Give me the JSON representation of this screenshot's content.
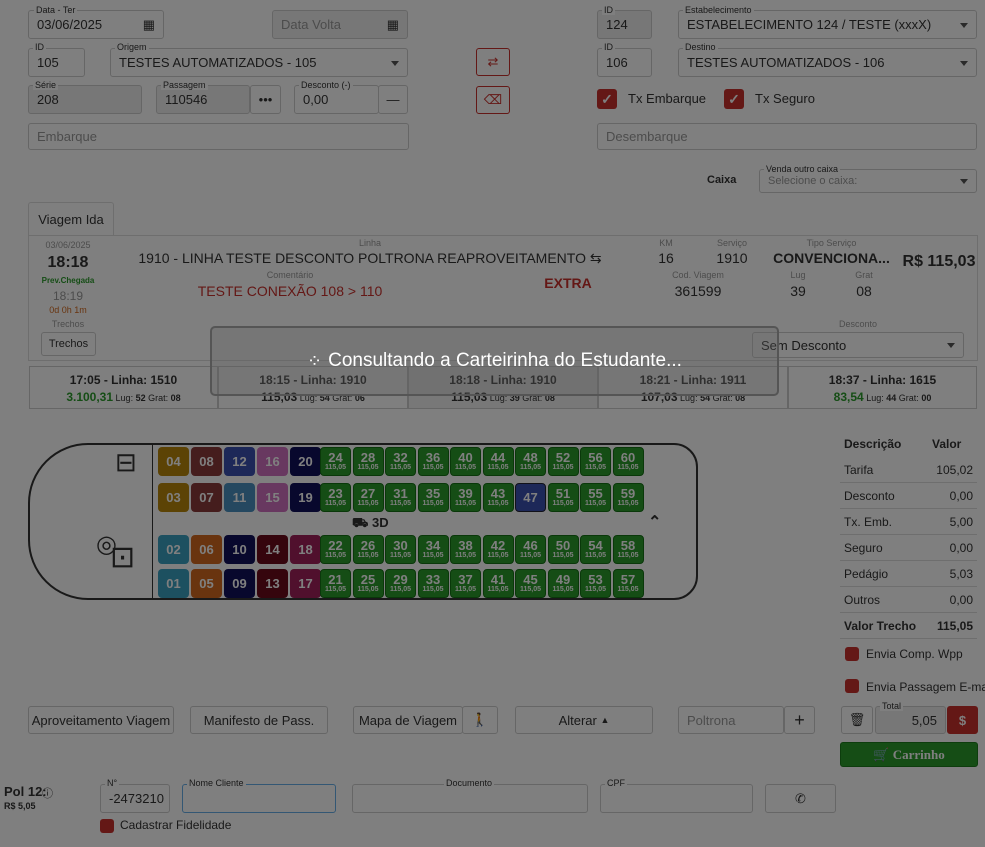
{
  "form": {
    "data_label": "Data - Ter",
    "data_value": "03/06/2025",
    "data_volta_placeholder": "Data Volta",
    "id_label": "ID",
    "id_value": "124",
    "estab_label": "Estabelecimento",
    "estab_value": "ESTABELECIMENTO 124 / TESTE (xxxX)",
    "origem_id_label": "ID",
    "origem_id": "105",
    "origem_label": "Origem",
    "origem_value": "TESTES AUTOMATIZADOS - 105",
    "destino_id_label": "ID",
    "destino_id": "106",
    "destino_label": "Destino",
    "destino_value": "TESTES AUTOMATIZADOS - 106",
    "serie_label": "Série",
    "serie_value": "208",
    "passagem_label": "Passagem",
    "passagem_value": "110546",
    "desconto_label": "Desconto (-)",
    "desconto_value": "0,00",
    "tx_embarque": "Tx Embarque",
    "tx_seguro": "Tx Seguro",
    "embarque_ph": "Embarque",
    "desembarque_ph": "Desembarque",
    "caixa": "Caixa",
    "venda_outro_caixa": "Venda outro caixa",
    "caixa_ph": "Selecione o caixa:"
  },
  "trip": {
    "tab": "Viagem Ida",
    "date": "03/06/2025",
    "time": "18:18",
    "prev": "Prev.Chegada",
    "prev_time": "18:19",
    "duration": "0d 0h 1m",
    "linha_label": "Linha",
    "linha": "1910 - LINHA TESTE DESCONTO POLTRONA REAPROVEITAMENTO",
    "km_label": "KM",
    "km": "16",
    "servico_label": "Serviço",
    "servico": "1910",
    "tipo_label": "Tipo Serviço",
    "tipo": "CONVENCIONA...",
    "price": "R$ 115,03",
    "comentario_label": "Comentário",
    "comentario": "TESTE CONEXÃO 108 > 110",
    "extra": "EXTRA",
    "cod_label": "Cod. Viagem",
    "cod": "361599",
    "lug_label": "Lug",
    "lug": "39",
    "grat_label": "Grat",
    "grat": "08",
    "trechos_label": "Trechos",
    "trechos_btn": "Trechos",
    "desconto_label": "Desconto",
    "desconto_value": "Sem Desconto"
  },
  "schedules": [
    {
      "title": "17:05 - Linha: 1510",
      "price": "3.100,31",
      "lug": "52",
      "grat": "08"
    },
    {
      "title": "18:15 - Linha: 1910",
      "price": "115,03",
      "lug": "54",
      "grat": "06"
    },
    {
      "title": "18:18 - Linha: 1910",
      "price": "115,03",
      "lug": "39",
      "grat": "08"
    },
    {
      "title": "18:21 - Linha: 1911",
      "price": "107,03",
      "lug": "54",
      "grat": "08"
    },
    {
      "title": "18:37 - Linha: 1615",
      "price": "83,54",
      "lug": "44",
      "grat": "00"
    }
  ],
  "sched_lug": "Lug:",
  "sched_grat": "Grat:",
  "bus_label": "3D",
  "seat_price": "115,05",
  "seats_occupied": [
    {
      "n": "04",
      "c": "#b8860b"
    },
    {
      "n": "08",
      "c": "#8b3a3a"
    },
    {
      "n": "12",
      "c": "#3a50b0"
    },
    {
      "n": "16",
      "c": "#d070c0"
    },
    {
      "n": "20",
      "c": "#10105a"
    },
    {
      "n": "03",
      "c": "#b8860b"
    },
    {
      "n": "07",
      "c": "#8b3a3a"
    },
    {
      "n": "11",
      "c": "#4a90c0"
    },
    {
      "n": "15",
      "c": "#d070c0"
    },
    {
      "n": "19",
      "c": "#10105a"
    },
    {
      "n": "02",
      "c": "#3aa0c0"
    },
    {
      "n": "06",
      "c": "#d2691e"
    },
    {
      "n": "10",
      "c": "#10105a"
    },
    {
      "n": "14",
      "c": "#6a0a1a"
    },
    {
      "n": "18",
      "c": "#a0205a"
    },
    {
      "n": "01",
      "c": "#3aa0c0"
    },
    {
      "n": "05",
      "c": "#d2691e"
    },
    {
      "n": "09",
      "c": "#10105a"
    },
    {
      "n": "13",
      "c": "#6a0a1a"
    },
    {
      "n": "17",
      "c": "#a0205a"
    }
  ],
  "seats_free": [
    [
      "24",
      "28",
      "32",
      "36",
      "40",
      "44",
      "48",
      "52",
      "56",
      "60"
    ],
    [
      "23",
      "27",
      "31",
      "35",
      "39",
      "43",
      "47",
      "51",
      "55",
      "59"
    ],
    [
      "22",
      "26",
      "30",
      "34",
      "38",
      "42",
      "46",
      "50",
      "54",
      "58"
    ],
    [
      "21",
      "25",
      "29",
      "33",
      "37",
      "41",
      "45",
      "49",
      "53",
      "57"
    ]
  ],
  "summary": {
    "h_desc": "Descrição",
    "h_val": "Valor",
    "rows": [
      [
        "Tarifa",
        "105,02"
      ],
      [
        "Desconto",
        "0,00"
      ],
      [
        "Tx. Emb.",
        "5,00"
      ],
      [
        "Seguro",
        "0,00"
      ],
      [
        "Pedágio",
        "5,03"
      ],
      [
        "Outros",
        "0,00"
      ]
    ],
    "trecho_label": "Valor Trecho",
    "trecho_value": "115,05",
    "envia_wpp": "Envia Comp. Wpp",
    "envia_email": "Envia Passagem E-mail",
    "total_label": "Total",
    "total_value": "5,05",
    "carrinho": "Carrinho"
  },
  "actions": {
    "aproveitamento": "Aproveitamento Viagem",
    "manifesto": "Manifesto de Pass.",
    "mapa": "Mapa de Viagem",
    "alterar": "Alterar",
    "poltrona_ph": "Poltrona"
  },
  "passenger": {
    "pol": "Pol 12:",
    "pol_price": "R$ 5,05",
    "n_label": "N°",
    "n_value": "-2473210",
    "nome_label": "Nome Cliente",
    "doc_label": "Documento",
    "cpf_label": "CPF",
    "fidelidade": "Cadastrar Fidelidade"
  },
  "modal": {
    "message": "Consultando a Carteirinha do Estudante..."
  }
}
